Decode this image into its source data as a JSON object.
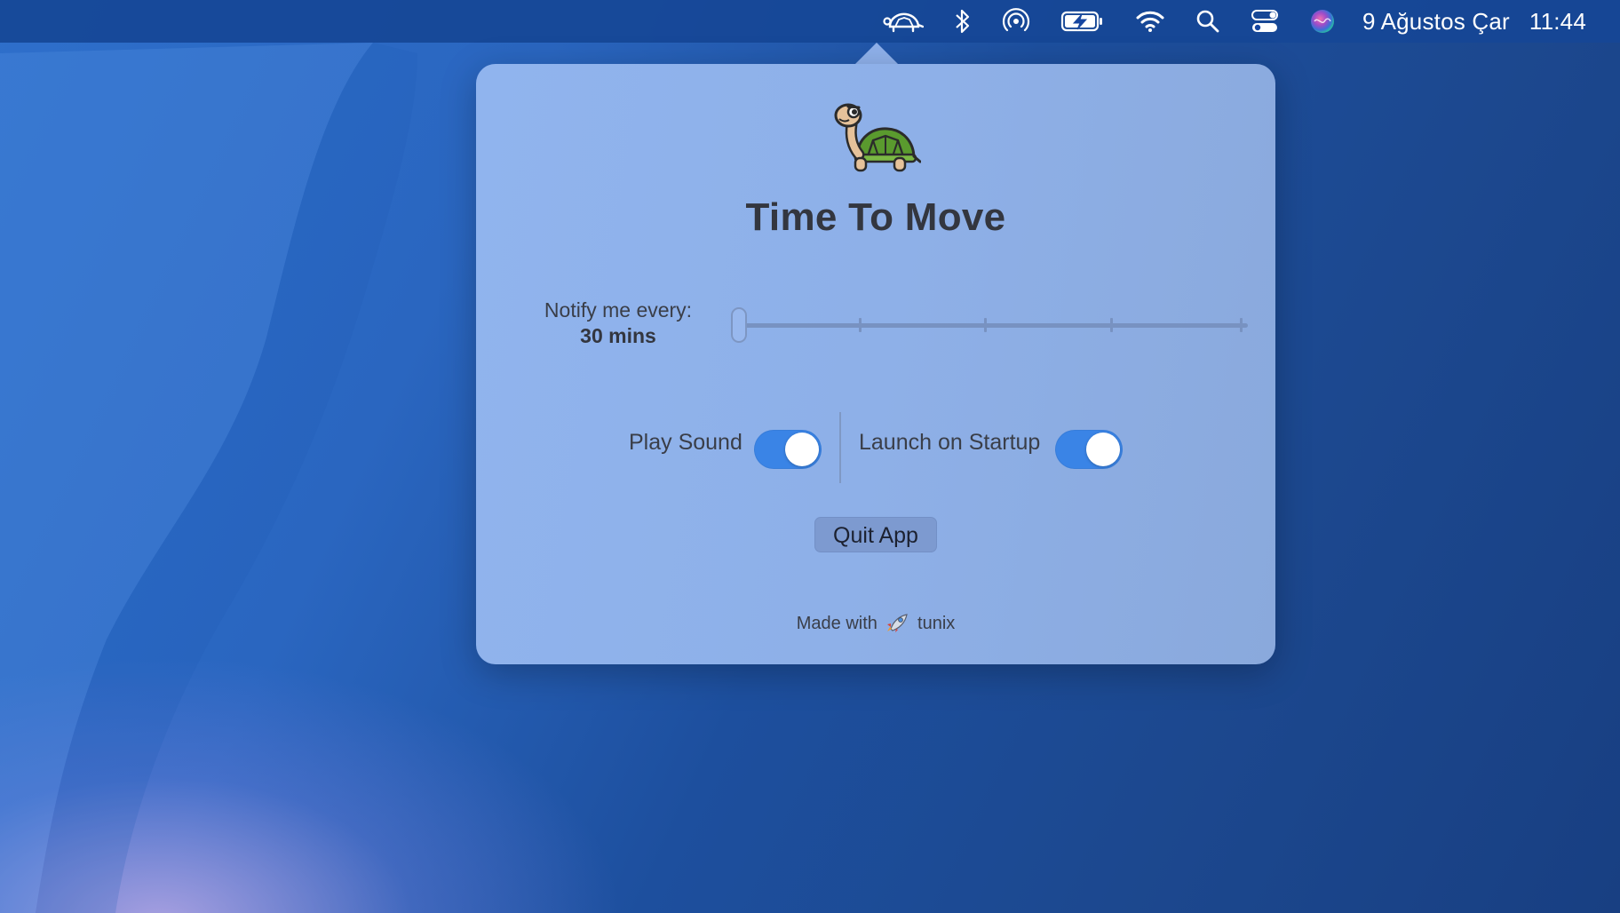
{
  "menubar": {
    "icons": [
      "turtle-icon",
      "bluetooth-icon",
      "airdrop-icon",
      "battery-charging-icon",
      "wifi-icon",
      "search-icon",
      "control-center-icon",
      "siri-icon"
    ],
    "date": "9 Ağustos Çar",
    "time": "11:44"
  },
  "popover": {
    "title": "Time To Move",
    "notify": {
      "label": "Notify me every:",
      "value": "30 mins",
      "slider_position_index": 0,
      "slider_tick_count": 5
    },
    "toggles": [
      {
        "label": "Play Sound",
        "on": true
      },
      {
        "label": "Launch on Startup",
        "on": true
      }
    ],
    "quit_label": "Quit App",
    "footer": {
      "prefix": "Made with",
      "icon": "rocket-icon",
      "suffix": "tunix"
    }
  },
  "colors": {
    "toggle_on": "#3a84e6",
    "popover_bg": "#8fb1eb",
    "menubar_bg": "#1646a0"
  }
}
